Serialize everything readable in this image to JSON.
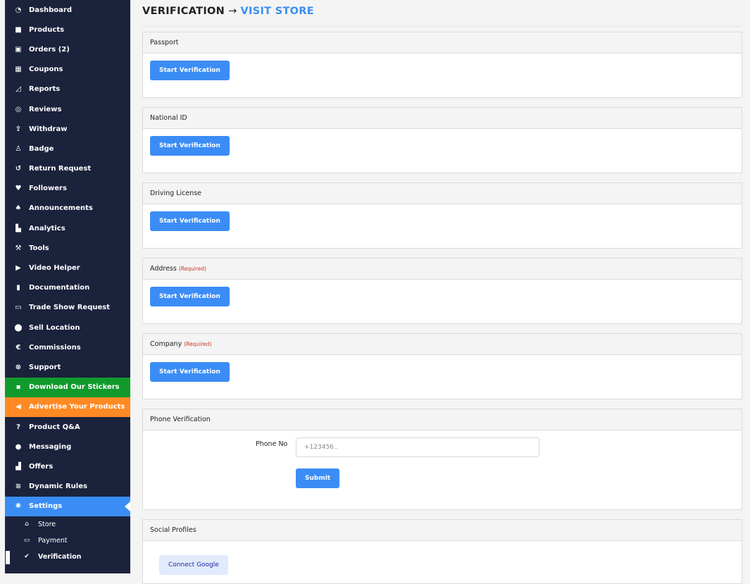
{
  "sidebar": {
    "items": [
      {
        "label": "Dashboard",
        "icon": "◔"
      },
      {
        "label": "Products",
        "icon": "■"
      },
      {
        "label": "Orders (2)",
        "icon": "🛒"
      },
      {
        "label": "Coupons",
        "icon": "▦"
      },
      {
        "label": "Reports",
        "icon": "◿"
      },
      {
        "label": "Reviews",
        "icon": "◎"
      },
      {
        "label": "Withdraw",
        "icon": "⇪"
      },
      {
        "label": "Badge",
        "icon": "♙"
      },
      {
        "label": "Return Request",
        "icon": "↺"
      },
      {
        "label": "Followers",
        "icon": "♥"
      },
      {
        "label": "Announcements",
        "icon": "♠"
      },
      {
        "label": "Analytics",
        "icon": "▙"
      },
      {
        "label": "Tools",
        "icon": "⚒"
      },
      {
        "label": "Video Helper",
        "icon": "▶"
      },
      {
        "label": "Documentation",
        "icon": "▮"
      },
      {
        "label": "Trade Show Request",
        "icon": "▭"
      },
      {
        "label": "Sell Location",
        "icon": "⬤"
      },
      {
        "label": "Commissions",
        "icon": "€"
      },
      {
        "label": "Support",
        "icon": "⊗"
      },
      {
        "label": "Download Our Stickers",
        "icon": "▪"
      },
      {
        "label": "Advertise Your Products",
        "icon": "◀"
      },
      {
        "label": "Product Q&A",
        "icon": "?"
      },
      {
        "label": "Messaging",
        "icon": "●"
      },
      {
        "label": "Offers",
        "icon": "▟"
      },
      {
        "label": "Dynamic Rules",
        "icon": "≋"
      },
      {
        "label": "Settings",
        "icon": "✺"
      }
    ],
    "subitems": [
      {
        "label": "Store",
        "icon": "⌂"
      },
      {
        "label": "Payment",
        "icon": "▭"
      },
      {
        "label": "Verification",
        "icon": "✔"
      }
    ]
  },
  "header": {
    "title": "VERIFICATION",
    "arrow": "→",
    "link": "VISIT STORE"
  },
  "panels": [
    {
      "title": "Passport",
      "required": "",
      "button": "Start Verification"
    },
    {
      "title": "National ID",
      "required": "",
      "button": "Start Verification"
    },
    {
      "title": "Driving License",
      "required": "",
      "button": "Start Verification"
    },
    {
      "title": "Address",
      "required": "(Required)",
      "button": "Start Verification"
    },
    {
      "title": "Company",
      "required": "(Required)",
      "button": "Start Verification"
    }
  ],
  "phone": {
    "title": "Phone Verification",
    "label": "Phone No",
    "placeholder": "+123456..",
    "value": "",
    "submit": "Submit"
  },
  "social": {
    "title": "Social Profiles",
    "google_button": "Connect Google"
  },
  "colors": {
    "sidebar_bg": "#1b223c",
    "accent": "#3b8df5",
    "green": "#119a2b",
    "orange": "#ff8a24",
    "required": "#c0392b"
  }
}
